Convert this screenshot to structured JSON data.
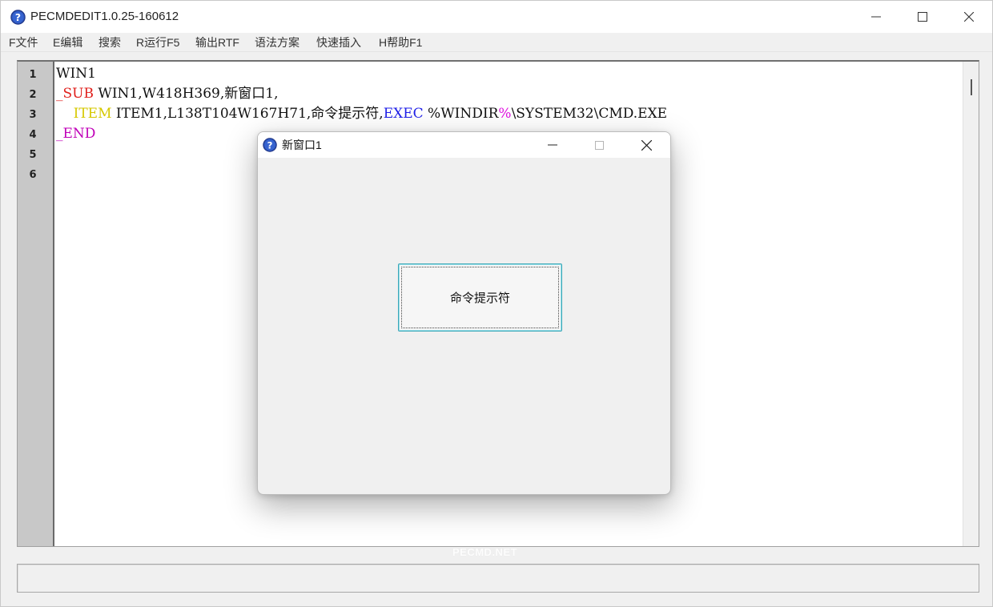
{
  "window": {
    "title": "PECMDEDIT1.0.25-160612"
  },
  "menu": [
    {
      "label": "F文件"
    },
    {
      "label": "E编辑"
    },
    {
      "label": "搜索"
    },
    {
      "label": "R运行F5"
    },
    {
      "label": "输出RTF"
    },
    {
      "label": "语法方案"
    },
    {
      "label": "快速插入"
    },
    {
      "label": "H帮助F1"
    }
  ],
  "editor": {
    "line_numbers": [
      "1",
      "2",
      "3",
      "4",
      "5",
      "6"
    ],
    "lines": [
      {
        "tokens": [
          {
            "text": "WIN1",
            "color": "default"
          }
        ]
      },
      {
        "tokens": [
          {
            "text": "_SUB",
            "color": "red"
          },
          {
            "text": " WIN1,W418H369,新窗口1,",
            "color": "default"
          }
        ]
      },
      {
        "tokens": [
          {
            "text": "    ITEM",
            "color": "yellow"
          },
          {
            "text": " ITEM1,L138T104W167H71,命令提示符,",
            "color": "default"
          },
          {
            "text": "EXEC",
            "color": "blue"
          },
          {
            "text": " %WINDIR",
            "color": "default"
          },
          {
            "text": "%",
            "color": "magenta"
          },
          {
            "text": "\\SYSTEM32\\CMD.EXE",
            "color": "default"
          }
        ]
      },
      {
        "tokens": [
          {
            "text": "_END",
            "color": "purple"
          }
        ]
      },
      {
        "tokens": []
      },
      {
        "tokens": []
      }
    ],
    "watermark": "PECMD.NET"
  },
  "popup": {
    "title": "新窗口1",
    "button_label": "命令提示符"
  },
  "icons": {
    "app": "help-question-icon",
    "minimize": "minimize-icon",
    "maximize": "maximize-icon",
    "close": "close-icon"
  },
  "colors": {
    "red": "#e0201c",
    "yellow": "#d6c800",
    "blue": "#2020e8",
    "magenta": "#e010e0",
    "purple": "#c000b8",
    "gutter": "#c8c8c8",
    "button_border": "#3aa7b8"
  }
}
